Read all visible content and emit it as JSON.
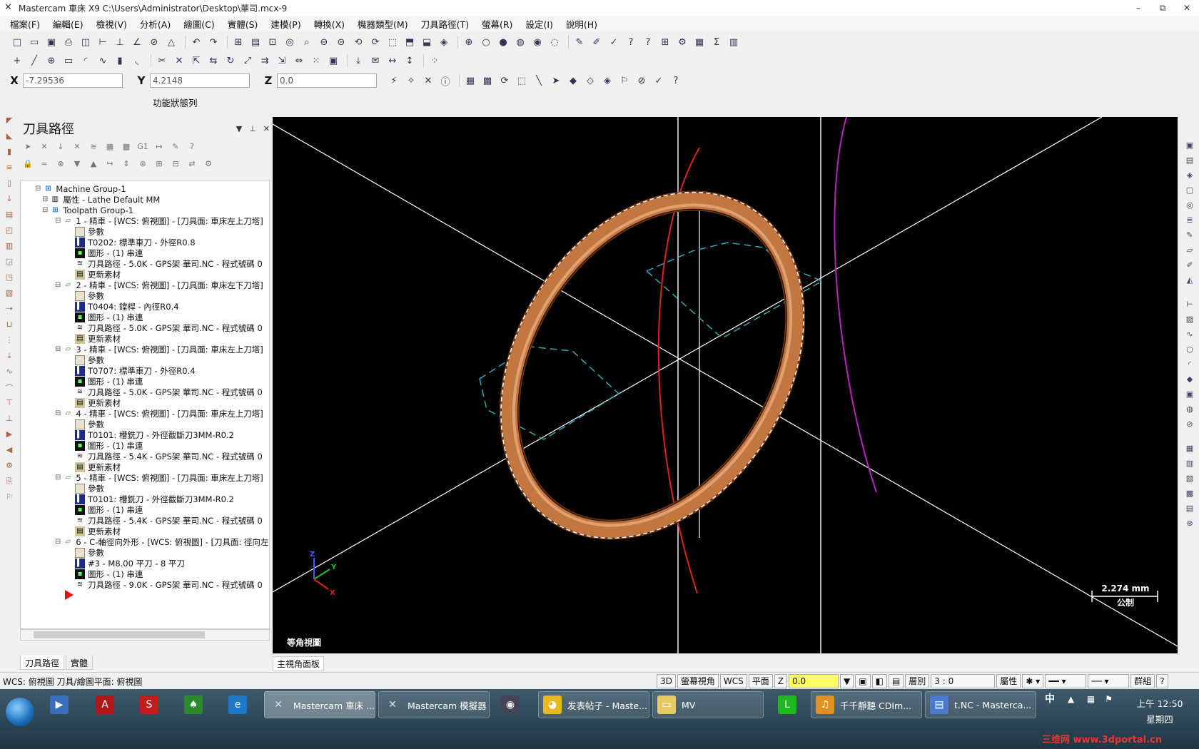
{
  "window": {
    "title": "Mastercam 車床 X9  C:\\Users\\Administrator\\Desktop\\華司.mcx-9",
    "minimize": "–",
    "restore": "⧉",
    "close": "✕"
  },
  "menu": [
    "檔案(F)",
    "編輯(E)",
    "檢視(V)",
    "分析(A)",
    "繪圖(C)",
    "實體(S)",
    "建模(P)",
    "轉換(X)",
    "機器類型(M)",
    "刀具路徑(T)",
    "螢幕(R)",
    "設定(I)",
    "說明(H)"
  ],
  "coords": {
    "x_label": "X",
    "x": "-7.29536",
    "y_label": "Y",
    "y": "4.2148",
    "z_label": "Z",
    "z": "0.0"
  },
  "function_bar_label": "功能狀態列",
  "panel": {
    "title": "刀具路徑",
    "tree": [
      {
        "text": "Machine Group-1",
        "icon": "grp",
        "level": 0
      },
      {
        "text": "屬性 - Lathe Default MM",
        "icon": "prop",
        "level": 1
      },
      {
        "text": "Toolpath Group-1",
        "icon": "grp",
        "level": 1
      },
      {
        "text": "1 - 精車 - [WCS: 俯視圖] - [刀具面: 車床左上刀塔]",
        "icon": "op",
        "level": 2
      },
      {
        "text": "參數",
        "icon": "folder",
        "level": 3
      },
      {
        "text": "T0202: 標準車刀 - 外徑R0.8",
        "icon": "tool",
        "level": 3
      },
      {
        "text": "圖形 - (1) 串連",
        "icon": "geo",
        "level": 3
      },
      {
        "text": "刀具路徑 - 5.0K - GPS架 華司.NC - 程式號碼 0",
        "icon": "path",
        "level": 3
      },
      {
        "text": "更新素材",
        "icon": "stock",
        "level": 3
      },
      {
        "text": "2 - 精車 - [WCS: 俯視圖] - [刀具面: 車床左下刀塔]",
        "icon": "op",
        "level": 2
      },
      {
        "text": "參數",
        "icon": "folder",
        "level": 3
      },
      {
        "text": "T0404: 鏜桿 - 內徑R0.4",
        "icon": "tool",
        "level": 3
      },
      {
        "text": "圖形 - (1) 串連",
        "icon": "geo",
        "level": 3
      },
      {
        "text": "刀具路徑 - 5.0K - GPS架 華司.NC - 程式號碼 0",
        "icon": "path",
        "level": 3
      },
      {
        "text": "更新素材",
        "icon": "stock",
        "level": 3
      },
      {
        "text": "3 - 精車 - [WCS: 俯視圖] - [刀具面: 車床左上刀塔]",
        "icon": "op",
        "level": 2
      },
      {
        "text": "參數",
        "icon": "folder",
        "level": 3
      },
      {
        "text": "T0707: 標準車刀 - 外徑R0.4",
        "icon": "tool",
        "level": 3
      },
      {
        "text": "圖形 - (1) 串連",
        "icon": "geo",
        "level": 3
      },
      {
        "text": "刀具路徑 - 5.0K - GPS架 華司.NC - 程式號碼 0",
        "icon": "path",
        "level": 3
      },
      {
        "text": "更新素材",
        "icon": "stock",
        "level": 3
      },
      {
        "text": "4 - 精車 - [WCS: 俯視圖] - [刀具面: 車床左上刀塔]",
        "icon": "op",
        "level": 2
      },
      {
        "text": "參數",
        "icon": "folder",
        "level": 3
      },
      {
        "text": "T0101: 槽銑刀 - 外徑截斷刀3MM-R0.2",
        "icon": "tool",
        "level": 3
      },
      {
        "text": "圖形 - (1) 串連",
        "icon": "geo",
        "level": 3
      },
      {
        "text": "刀具路徑 - 5.4K - GPS架 華司.NC - 程式號碼 0",
        "icon": "path",
        "level": 3
      },
      {
        "text": "更新素材",
        "icon": "stock",
        "level": 3
      },
      {
        "text": "5 - 精車 - [WCS: 俯視圖] - [刀具面: 車床左上刀塔]",
        "icon": "op",
        "level": 2
      },
      {
        "text": "參數",
        "icon": "folder",
        "level": 3
      },
      {
        "text": "T0101: 槽銑刀 - 外徑截斷刀3MM-R0.2",
        "icon": "tool",
        "level": 3
      },
      {
        "text": "圖形 - (1) 串連",
        "icon": "geo",
        "level": 3
      },
      {
        "text": "刀具路徑 - 5.4K - GPS架 華司.NC - 程式號碼 0",
        "icon": "path",
        "level": 3
      },
      {
        "text": "更新素材",
        "icon": "stock",
        "level": 3
      },
      {
        "text": "6 - C-軸徑向外形 - [WCS: 俯視圖] - [刀具面: 徑向左",
        "icon": "op",
        "level": 2
      },
      {
        "text": "參數",
        "icon": "folder",
        "level": 3
      },
      {
        "text": "#3 - M8.00 平刀 - 8 平刀",
        "icon": "tool",
        "level": 3
      },
      {
        "text": "圖形 - (1) 串連",
        "icon": "geo",
        "level": 3
      },
      {
        "text": "刀具路徑 - 9.0K - GPS架 華司.NC - 程式號碼 0",
        "icon": "path",
        "level": 3
      }
    ],
    "tabs": [
      "刀具路徑",
      "實體"
    ]
  },
  "viewport": {
    "view_name": "等角視圖",
    "scale_value": "2.274 mm",
    "scale_unit": "公制",
    "tab": "主視角面板",
    "axis_x": "X",
    "axis_y": "Y",
    "axis_z": "Z"
  },
  "statusbar": {
    "wcs_text": "WCS: 俯視圖  刀具/繪圖平面: 俯視圖",
    "btn_3d": "3D",
    "screen_view": "螢幕視角",
    "wcs": "WCS",
    "plane": "平面",
    "z_label": "Z",
    "z_value": "0.0",
    "level_label": "層別",
    "level_value": "3 : 0",
    "attrib": "屬性",
    "group": "群組",
    "help": "?"
  },
  "taskbar": {
    "apps": [
      {
        "label": "Mastercam 車床 ...",
        "active": true
      },
      {
        "label": "Mastercam 模擬器",
        "active": false
      },
      {
        "label": "发表帖子 - Maste...",
        "active": false
      },
      {
        "label": "MV",
        "active": false
      },
      {
        "label": "千千靜聽    CDIm...",
        "active": false
      },
      {
        "label": "t.NC - Masterca...",
        "active": false
      }
    ],
    "ime": "中",
    "time": "上午 12:50",
    "day": "星期四",
    "watermark": "三维网 www.3dportal.cn"
  },
  "colors": {
    "viewport_bg": "#000000",
    "part": "#b86a3c",
    "toolpath_red": "#e02020",
    "toolpath_magenta": "#c020c0",
    "toolpath_cyan": "#2fa8b8"
  }
}
